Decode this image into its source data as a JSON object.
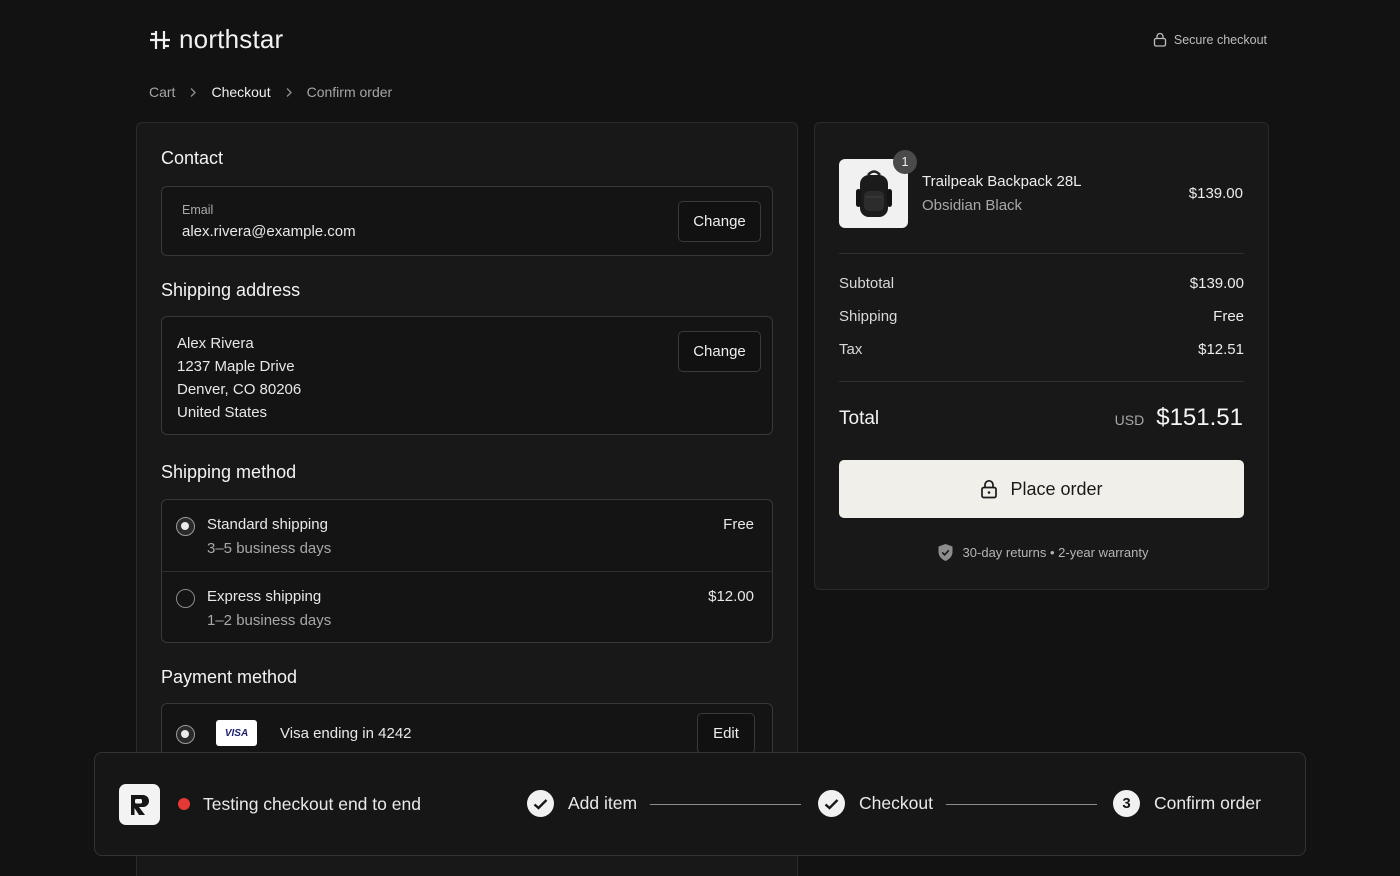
{
  "brand": {
    "name": "northstar"
  },
  "header": {
    "secure_label": "Secure checkout"
  },
  "breadcrumb": {
    "items": [
      "Cart",
      "Checkout",
      "Confirm order"
    ]
  },
  "contact": {
    "title": "Contact",
    "email_label": "Email",
    "email_value": "alex.rivera@example.com",
    "change_label": "Change"
  },
  "shipping_address": {
    "title": "Shipping address",
    "lines": [
      "Alex Rivera",
      "1237 Maple Drive",
      "Denver, CO 80206",
      "United States"
    ],
    "change_label": "Change"
  },
  "shipping_method": {
    "title": "Shipping method",
    "options": [
      {
        "name": "Standard shipping",
        "detail": "3–5 business days",
        "price": "Free",
        "selected": true
      },
      {
        "name": "Express shipping",
        "detail": "1–2 business days",
        "price": "$12.00",
        "selected": false
      }
    ]
  },
  "payment": {
    "title": "Payment method",
    "card_brand": "VISA",
    "card_label": "Visa ending in 4242",
    "edit_label": "Edit"
  },
  "summary": {
    "item": {
      "quantity": "1",
      "name": "Trailpeak Backpack 28L",
      "variant": "Obsidian Black",
      "price": "$139.00"
    },
    "subtotal_label": "Subtotal",
    "subtotal_value": "$139.00",
    "shipping_label": "Shipping",
    "shipping_value": "Free",
    "tax_label": "Tax",
    "tax_value": "$12.51",
    "total_label": "Total",
    "currency": "USD",
    "total_value": "$151.51",
    "place_order_label": "Place order",
    "guarantee": "30-day returns • 2-year warranty"
  },
  "test_run": {
    "title": "Testing checkout end to end",
    "steps": [
      {
        "label": "Add item",
        "status": "done"
      },
      {
        "label": "Checkout",
        "status": "done"
      },
      {
        "label": "Confirm order",
        "status": "current",
        "number": "3"
      }
    ]
  },
  "colors": {
    "background": "#121212",
    "panel": "#181818",
    "primary_button": "#f1efea",
    "recording_dot": "#e53935"
  }
}
